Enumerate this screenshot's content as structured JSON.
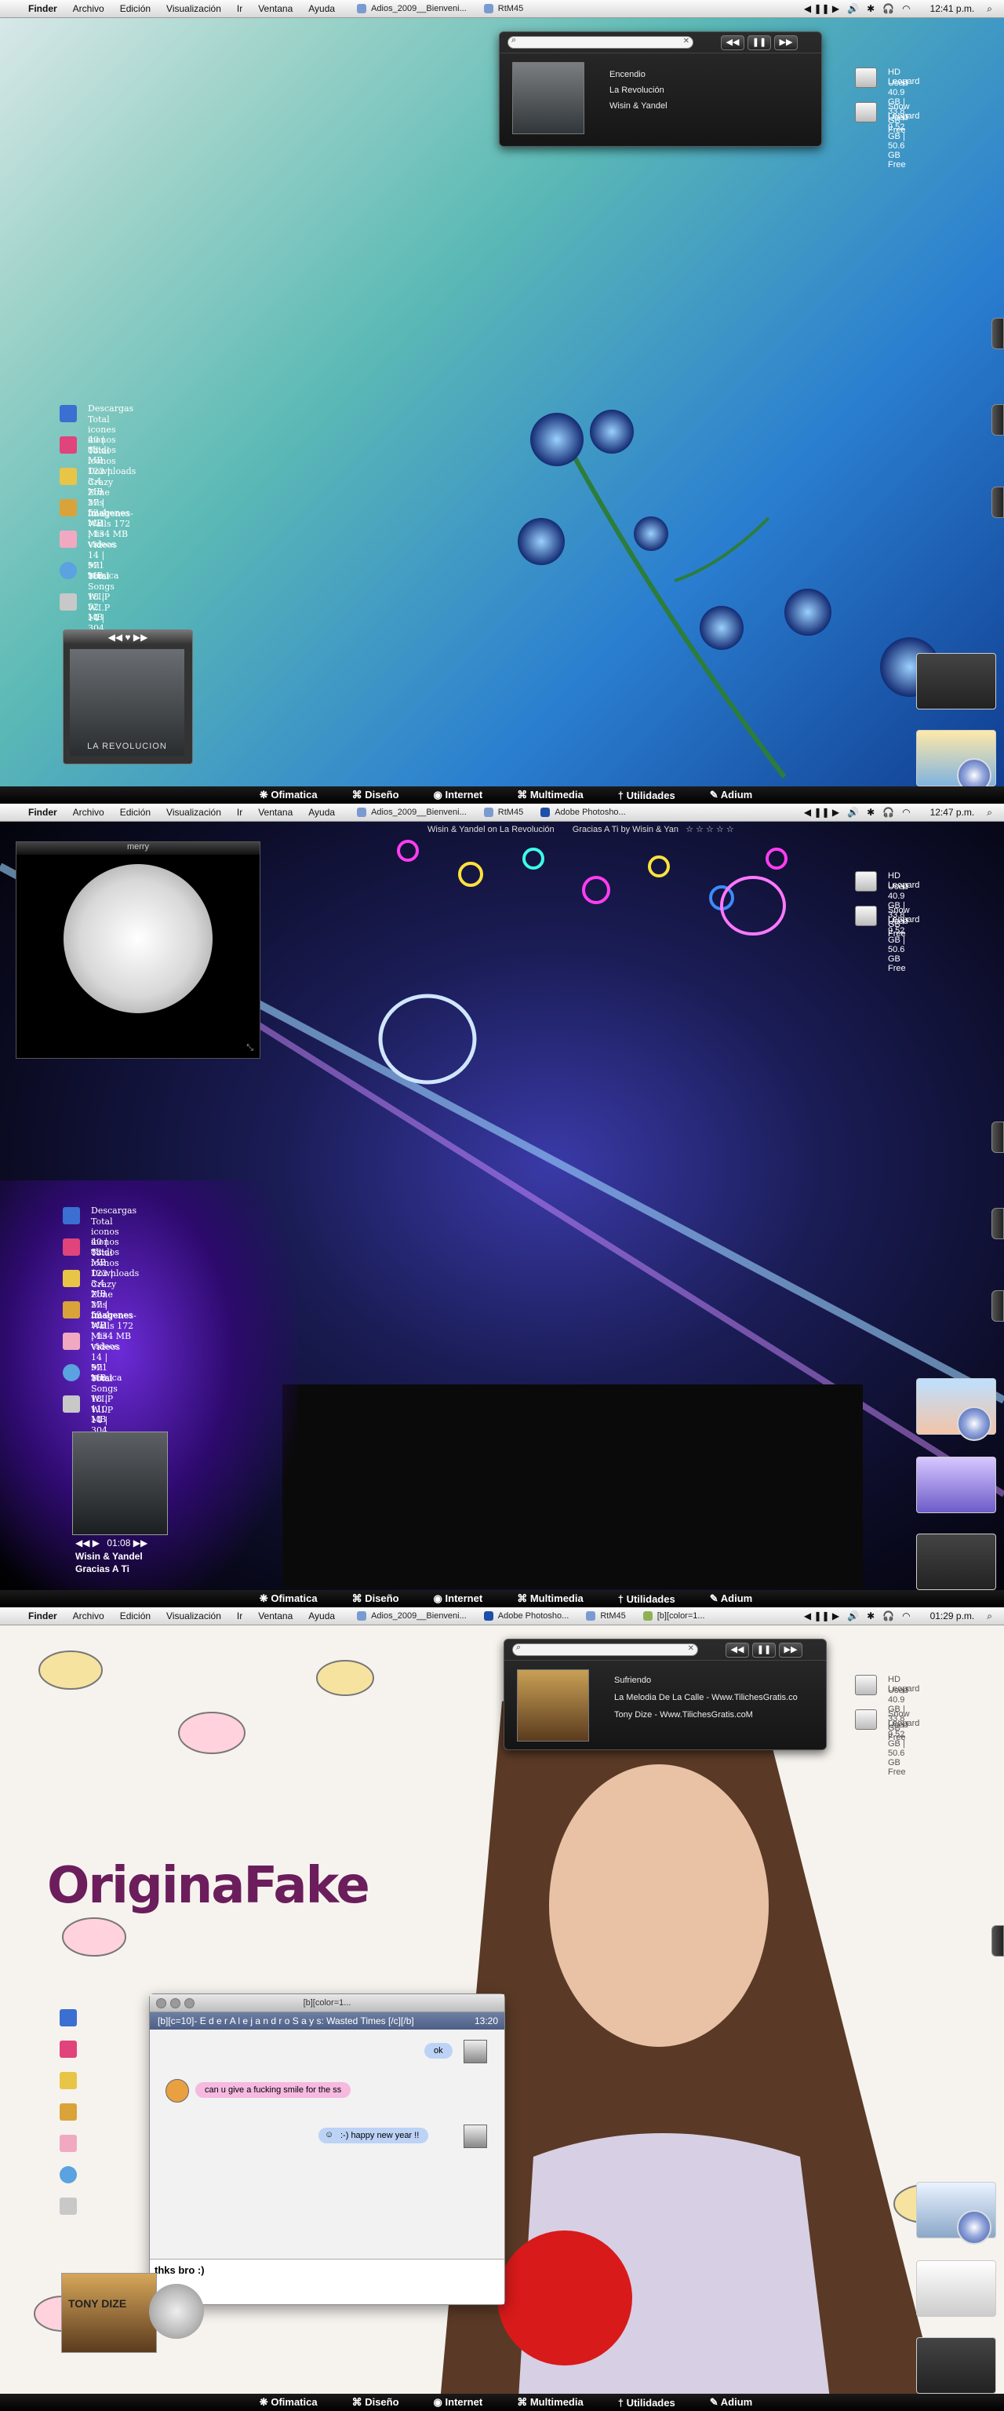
{
  "menu": {
    "apple": "",
    "items": [
      "Finder",
      "Archivo",
      "Edición",
      "Visualización",
      "Ir",
      "Ventana",
      "Ayuda"
    ]
  },
  "screen1": {
    "running": [
      "Adios_2009__Bienveni...",
      "RtM45"
    ],
    "clock": "12:41 p.m.",
    "itunes": {
      "line1": "Encendio",
      "line2": "La Revolución",
      "line3": "Wisin & Yandel"
    },
    "drives": [
      {
        "name": "HD Leopard",
        "info": "Used 40.9 GB | 33.8 GB Free"
      },
      {
        "name": "Snow Leopard",
        "info": "Used 9.52 GB | 50.6 GB Free"
      }
    ],
    "folders": [
      {
        "name": "Descargas",
        "detail": "Total icones 40 | 52 MB"
      },
      {
        "name": "iconos chidos",
        "detail": "Total iconos 122 | 3.4 MB"
      },
      {
        "name": "Downloads",
        "detail": "Crazy Zone 27 | 52.4 MB"
      },
      {
        "name": "Mis imagenes",
        "detail": "Imagenes-Walls 172 | 134 MB"
      },
      {
        "name": "Mis videos",
        "detail": "Videos 14 | 971 MB"
      },
      {
        "name": "Mi musica",
        "detail": "Total Songs 18 | 52 MB"
      },
      {
        "name": "W.I.P",
        "detail": "W.I.P 14 | 304 MB"
      }
    ],
    "album_caption": "LA REVOLUCION"
  },
  "screen2": {
    "running": [
      "Adios_2009__Bienveni...",
      "RtM45",
      "Adobe Photosho..."
    ],
    "clock": "12:47 p.m.",
    "status": "Wisin & Yandel on La Revolución",
    "status2": "Gracias A Ti by Wisin & Yan",
    "widget_title": "merry",
    "drives": [
      {
        "name": "HD Leopard",
        "info": "Used 40.9 GB | 33.8 GB Free"
      },
      {
        "name": "Snow Leopard",
        "info": "Used 9.52 GB | 50.6 GB Free"
      }
    ],
    "folders": [
      {
        "name": "Descargas",
        "detail": "Total iconos 40 | 52 MB"
      },
      {
        "name": "iconos chidos",
        "detail": "Total iconos 122 | 3.4 MB"
      },
      {
        "name": "Downloads",
        "detail": "Crazy Zone 27 | 52.4 MB"
      },
      {
        "name": "Mis imagenes",
        "detail": "Imagenes-Walls 172 | 134 MB"
      },
      {
        "name": "Mis videos",
        "detail": "Videos 14 | 971 MB"
      },
      {
        "name": "Mi musica",
        "detail": "Total Songs 18 | 110 MB"
      },
      {
        "name": "W.I.P",
        "detail": "W.I.P 14 | 304 MB"
      }
    ],
    "now_playing": {
      "time": "01:08",
      "artist": "Wisin & Yandel",
      "song": "Gracias A Ti"
    }
  },
  "screen3": {
    "running": [
      "Adios_2009__Bienveni...",
      "Adobe Photosho...",
      "RtM45",
      "[b][color=1..."
    ],
    "clock": "01:29 p.m.",
    "itunes": {
      "line1": "Sufriendo",
      "line2": "La Melodia De La Calle - Www.TilichesGratis.co",
      "line3": "Tony Dize - Www.TilichesGratis.coM"
    },
    "drives": [
      {
        "name": "HD Leopard",
        "info": "Used 40.9 GB | 33.8 GB Free"
      },
      {
        "name": "Snow Leopard",
        "info": "Used 9.52 GB | 50.6 GB Free"
      }
    ],
    "logo": {
      "part1": "Origina",
      "part2": "Fake"
    },
    "chat": {
      "title": "[b][color=1...",
      "banner": "[b][c=10]- E d e r A l e j a n d r o S a y s: Wasted Times [/c][/b]",
      "time": "13:20",
      "msg_ok": "ok",
      "msg_smile": "can u give a fucking smile for the ss",
      "msg_happy": ":-) happy new year !!",
      "input": "thks bro :)"
    },
    "album_caption": "TONY DIZE"
  },
  "dock": {
    "apple": "",
    "items": [
      "Ofimatica",
      "Diseño",
      "Internet",
      "Multimedia",
      "Utilidades",
      "Adium"
    ],
    "icons": [
      "❋",
      "⌘",
      "◉",
      "⌘",
      "†",
      "✎"
    ]
  }
}
